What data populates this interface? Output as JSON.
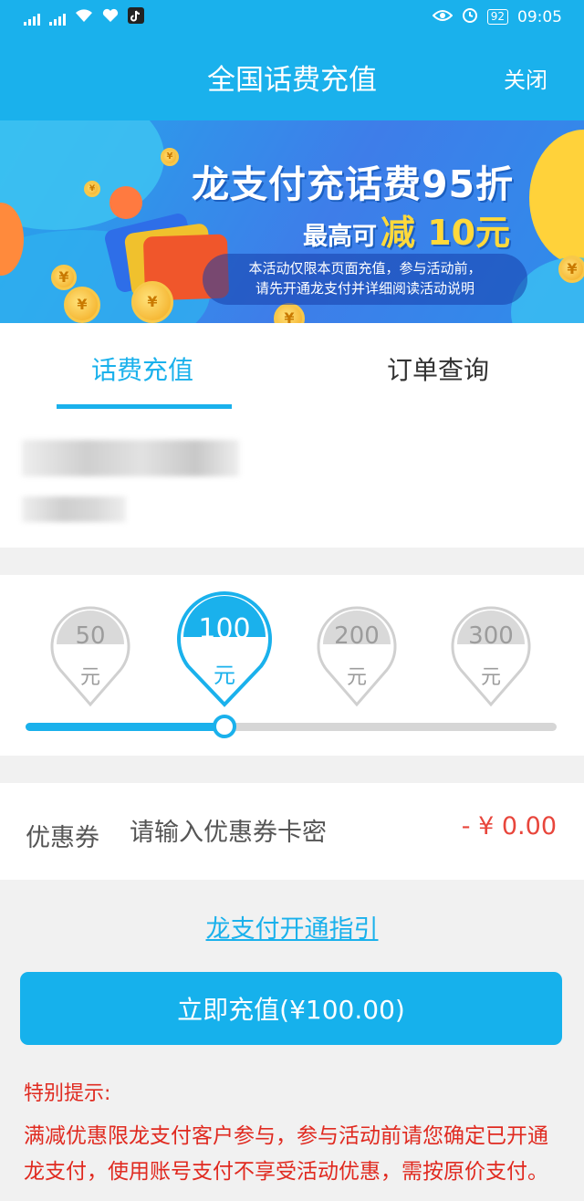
{
  "status_bar": {
    "signal1": "4G",
    "signal2": "2G",
    "battery": "92",
    "time": "09:05"
  },
  "header": {
    "title": "全国话费充值",
    "close_label": "关闭"
  },
  "banner": {
    "headline": "龙支付充话费95折",
    "sub_prefix": "最高可",
    "sub_highlight": "减 10元",
    "note_line1": "本活动仅限本页面充值，参与活动前，",
    "note_line2": "请先开通龙支付并详细阅读活动说明"
  },
  "tabs": [
    {
      "label": "话费充值",
      "active": true
    },
    {
      "label": "订单查询",
      "active": false
    }
  ],
  "amount_options": [
    {
      "value": "50",
      "unit": "元",
      "selected": false
    },
    {
      "value": "100",
      "unit": "元",
      "selected": true
    },
    {
      "value": "200",
      "unit": "元",
      "selected": false
    },
    {
      "value": "300",
      "unit": "元",
      "selected": false
    }
  ],
  "slider": {
    "selected_fraction": 0.375
  },
  "coupon": {
    "label": "优惠券",
    "placeholder": "请输入优惠券卡密",
    "discount": "- ¥ 0.00"
  },
  "guide_link": "龙支付开通指引",
  "pay_button": "立即充值(¥100.00)",
  "tips": {
    "title": "特别提示:",
    "body": "满减优惠限龙支付客户参与，参与活动前请您确定已开通龙支付，使用账号支付不享受活动优惠，需按原价支付。"
  },
  "colors": {
    "primary": "#1ab1ec",
    "warning": "#e02a20",
    "discount": "#e8463c"
  }
}
